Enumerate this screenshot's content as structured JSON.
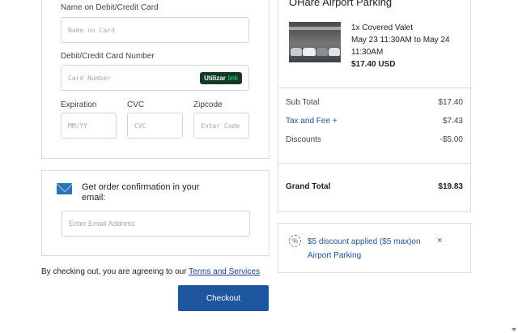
{
  "payment": {
    "name_label": "Name on Debit/Credit Card",
    "name_placeholder": "Name on Card",
    "number_label": "Debit/Credit Card Number",
    "number_placeholder": "Card Number",
    "link_badge": {
      "prefix": "Utilizar",
      "brand": "link"
    },
    "expiration_label": "Expiration",
    "expiration_placeholder": "MM/YY",
    "cvc_label": "CVC",
    "cvc_placeholder": "CVC",
    "zip_label": "Zipcode",
    "zip_placeholder": "Enter Code"
  },
  "email": {
    "icon": "envelope-icon",
    "text": "Get order confirmation in your email:",
    "placeholder": "Enter Email Address"
  },
  "terms": {
    "text": "By checking out, you are agreeing to our ",
    "link": "Terms and Services"
  },
  "checkout": {
    "label": "Checkout"
  },
  "summary": {
    "title": "OHare Airport Parking",
    "item": {
      "name": "1x Covered Valet",
      "dates": "May 23 11:30AM to May 24 11:30AM",
      "price": "$17.40 USD"
    },
    "rows": [
      {
        "label": "Sub Total",
        "value": "$17.40"
      },
      {
        "label": "Tax and Fee +",
        "value": "$7.43"
      },
      {
        "label": "Discounts",
        "value": "-$5.00"
      }
    ],
    "grand_total": {
      "label": "Grand Total",
      "value": "$19.83"
    }
  },
  "discount": {
    "icon": "percent-badge-icon",
    "text": "$5 discount applied ($5 max)on Airport Parking",
    "close": "×"
  },
  "colors": {
    "accent": "#1f56a0",
    "link_badge_bg": "#123a24",
    "link_green": "#33e07a"
  }
}
